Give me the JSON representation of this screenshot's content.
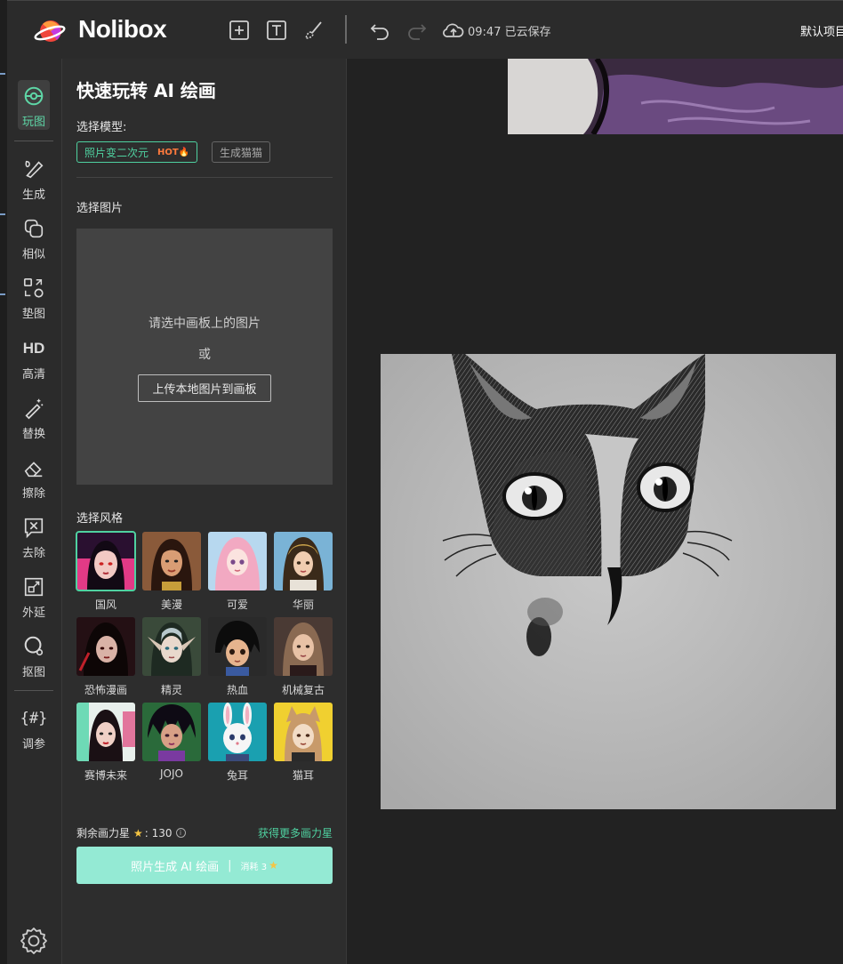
{
  "app": {
    "name": "Nolibox"
  },
  "toolbar": {
    "add_tool": "add-frame",
    "text_tool": "text",
    "brush_tool": "brush",
    "undo": "undo",
    "redo": "redo",
    "save_status": "09:47 已云保存",
    "project_name": "默认项目"
  },
  "nav": {
    "items": [
      {
        "label": "玩图",
        "icon": "palette-icon",
        "active": true
      },
      {
        "label": "生成",
        "icon": "brush-pencil-icon"
      },
      {
        "label": "相似",
        "icon": "overlap-squares-icon"
      },
      {
        "label": "垫图",
        "icon": "swap-icon"
      },
      {
        "label": "高清",
        "icon": "hd-icon"
      },
      {
        "label": "替换",
        "icon": "magic-wand-icon"
      },
      {
        "label": "擦除",
        "icon": "eraser-icon"
      },
      {
        "label": "去除",
        "icon": "remove-icon"
      },
      {
        "label": "外延",
        "icon": "expand-icon"
      },
      {
        "label": "抠图",
        "icon": "lasso-icon"
      },
      {
        "label": "调参",
        "icon": "hash-icon"
      }
    ]
  },
  "panel": {
    "title": "快速玩转 AI 绘画",
    "model_label": "选择模型:",
    "models": [
      {
        "label": "照片变二次元",
        "badge": "HOT🔥",
        "selected": true
      },
      {
        "label": "生成猫猫",
        "selected": false
      }
    ],
    "image_label": "选择图片",
    "dropzone": {
      "hint": "请选中画板上的图片",
      "or": "或",
      "upload_label": "上传本地图片到画板"
    },
    "style_label": "选择风格",
    "styles": [
      {
        "name": "国风",
        "selected": true
      },
      {
        "name": "美漫"
      },
      {
        "name": "可爱"
      },
      {
        "name": "华丽"
      },
      {
        "name": "恐怖漫画"
      },
      {
        "name": "精灵"
      },
      {
        "name": "热血"
      },
      {
        "name": "机械复古"
      },
      {
        "name": "赛博未来"
      },
      {
        "name": "JOJO"
      },
      {
        "name": "兔耳"
      },
      {
        "name": "猫耳"
      }
    ],
    "balance_label": "剩余画力星",
    "balance_value": "130",
    "more_link": "获得更多画力星",
    "generate_label": "照片生成 AI 绘画",
    "generate_sep": "|",
    "generate_cost": "消耗 3"
  },
  "colors": {
    "accent": "#4fd1a0",
    "button": "#94ead4",
    "hot": "#ff7a3d",
    "star": "#f5c542"
  }
}
